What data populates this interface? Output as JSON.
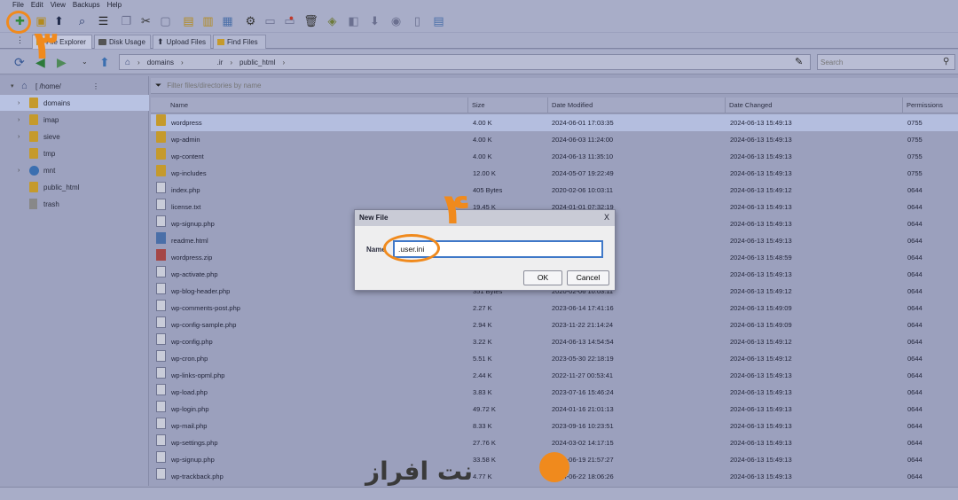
{
  "menu": [
    "File",
    "Edit",
    "View",
    "Backups",
    "Help"
  ],
  "tabs": {
    "file_explorer": "File Explorer",
    "disk_usage": "Disk Usage",
    "upload_files": "Upload Files",
    "find_files": "Find Files"
  },
  "address": {
    "segments": [
      "domains",
      ".ir",
      "public_html"
    ],
    "search_placeholder": "Search"
  },
  "tree": {
    "root": "[ /home/",
    "items": [
      "domains",
      "imap",
      "sieve",
      "tmp",
      "mnt",
      "public_html",
      "trash"
    ]
  },
  "filter_placeholder": "Filter files/directories by name",
  "columns": [
    "Name",
    "Size",
    "Date Modified",
    "Date Changed",
    "Permissions"
  ],
  "files": [
    {
      "name": "wordpress",
      "size": "4.00 K",
      "modified": "2024-06-01 17:03:35",
      "changed": "2024-06-13 15:49:13",
      "perm": "0755",
      "kind": "folder"
    },
    {
      "name": "wp-admin",
      "size": "4.00 K",
      "modified": "2024-06-03 11:24:00",
      "changed": "2024-06-13 15:49:13",
      "perm": "0755",
      "kind": "folder"
    },
    {
      "name": "wp-content",
      "size": "4.00 K",
      "modified": "2024-06-13 11:35:10",
      "changed": "2024-06-13 15:49:13",
      "perm": "0755",
      "kind": "folder"
    },
    {
      "name": "wp-includes",
      "size": "12.00 K",
      "modified": "2024-05-07 19:22:49",
      "changed": "2024-06-13 15:49:13",
      "perm": "0755",
      "kind": "folder"
    },
    {
      "name": "index.php",
      "size": "405 Bytes",
      "modified": "2020-02-06 10:03:11",
      "changed": "2024-06-13 15:49:12",
      "perm": "0644",
      "kind": "doc"
    },
    {
      "name": "license.txt",
      "size": "19.45 K",
      "modified": "2024-01-01 07:32:19",
      "changed": "2024-06-13 15:49:13",
      "perm": "0644",
      "kind": "doc"
    },
    {
      "name": "wp-signup.php",
      "size": "",
      "modified": "",
      "changed": "2024-06-13 15:49:13",
      "perm": "0644",
      "kind": "doc"
    },
    {
      "name": "readme.html",
      "size": "",
      "modified": "",
      "changed": "2024-06-13 15:49:13",
      "perm": "0644",
      "kind": "htmlf"
    },
    {
      "name": "wordpress.zip",
      "size": "",
      "modified": "",
      "changed": "2024-06-13 15:48:59",
      "perm": "0644",
      "kind": "zip"
    },
    {
      "name": "wp-activate.php",
      "size": "",
      "modified": "",
      "changed": "2024-06-13 15:49:13",
      "perm": "0644",
      "kind": "doc"
    },
    {
      "name": "wp-blog-header.php",
      "size": "351 Bytes",
      "modified": "2020-02-06 10:03:11",
      "changed": "2024-06-13 15:49:12",
      "perm": "0644",
      "kind": "doc"
    },
    {
      "name": "wp-comments-post.php",
      "size": "2.27 K",
      "modified": "2023-06-14 17:41:16",
      "changed": "2024-06-13 15:49:09",
      "perm": "0644",
      "kind": "doc"
    },
    {
      "name": "wp-config-sample.php",
      "size": "2.94 K",
      "modified": "2023-11-22 21:14:24",
      "changed": "2024-06-13 15:49:09",
      "perm": "0644",
      "kind": "doc"
    },
    {
      "name": "wp-config.php",
      "size": "3.22 K",
      "modified": "2024-06-13 14:54:54",
      "changed": "2024-06-13 15:49:12",
      "perm": "0644",
      "kind": "doc"
    },
    {
      "name": "wp-cron.php",
      "size": "5.51 K",
      "modified": "2023-05-30 22:18:19",
      "changed": "2024-06-13 15:49:12",
      "perm": "0644",
      "kind": "doc"
    },
    {
      "name": "wp-links-opml.php",
      "size": "2.44 K",
      "modified": "2022-11-27 00:53:41",
      "changed": "2024-06-13 15:49:13",
      "perm": "0644",
      "kind": "doc"
    },
    {
      "name": "wp-load.php",
      "size": "3.83 K",
      "modified": "2023-07-16 15:46:24",
      "changed": "2024-06-13 15:49:13",
      "perm": "0644",
      "kind": "doc"
    },
    {
      "name": "wp-login.php",
      "size": "49.72 K",
      "modified": "2024-01-16 21:01:13",
      "changed": "2024-06-13 15:49:13",
      "perm": "0644",
      "kind": "doc"
    },
    {
      "name": "wp-mail.php",
      "size": "8.33 K",
      "modified": "2023-09-16 10:23:51",
      "changed": "2024-06-13 15:49:13",
      "perm": "0644",
      "kind": "doc"
    },
    {
      "name": "wp-settings.php",
      "size": "27.76 K",
      "modified": "2024-03-02 14:17:15",
      "changed": "2024-06-13 15:49:13",
      "perm": "0644",
      "kind": "doc"
    },
    {
      "name": "wp-signup.php",
      "size": "33.58 K",
      "modified": "2024-06-19 21:57:27",
      "changed": "2024-06-13 15:49:13",
      "perm": "0644",
      "kind": "doc"
    },
    {
      "name": "wp-trackback.php",
      "size": "4.77 K",
      "modified": "2024-06-22 18:06:26",
      "changed": "2024-06-13 15:49:13",
      "perm": "0644",
      "kind": "doc"
    }
  ],
  "dialog": {
    "title": "New File",
    "close": "X",
    "label": "Name",
    "value": ".user.ini",
    "ok": "OK",
    "cancel": "Cancel"
  },
  "annotations": {
    "step3": "۳",
    "step4": "۴",
    "color": "#f08a1d"
  },
  "logo": {
    "text": "نت افراز"
  }
}
